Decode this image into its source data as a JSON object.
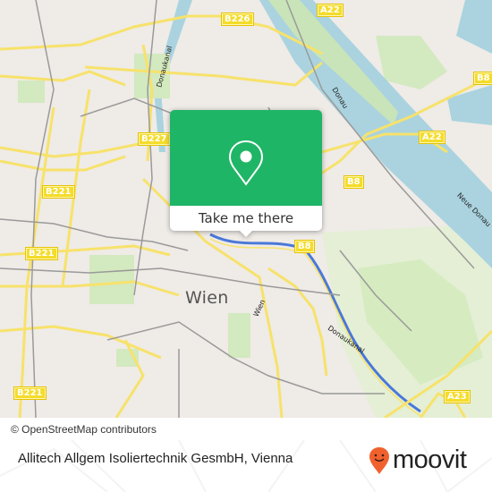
{
  "map": {
    "city_label": "Wien",
    "water_labels": {
      "danube": "Donau",
      "new_danube": "Neue Donau",
      "danube_canal": "Donaukanal",
      "wien_river": "Wien",
      "canal_north": "Donaukanal"
    },
    "road_shields": [
      {
        "id": "b226",
        "label": "B226"
      },
      {
        "id": "a22-top",
        "label": "A22"
      },
      {
        "id": "b227",
        "label": "B227"
      },
      {
        "id": "b8-right",
        "label": "B8"
      },
      {
        "id": "a22-mid",
        "label": "A22"
      },
      {
        "id": "b221-upper",
        "label": "B221"
      },
      {
        "id": "b8-center",
        "label": "B8"
      },
      {
        "id": "b221-mid",
        "label": "B221"
      },
      {
        "id": "b8-lower",
        "label": "B8"
      },
      {
        "id": "b221-lower",
        "label": "B221"
      },
      {
        "id": "a23",
        "label": "A23"
      }
    ],
    "colors": {
      "land": "#efebe7",
      "water": "#aad3df",
      "park": "#cdebb0",
      "major_road": "#f7e26b",
      "rail": "#999999"
    }
  },
  "popup": {
    "icon": "location-pin-icon",
    "button_label": "Take me there",
    "color": "#1fb566"
  },
  "attribution": "© OpenStreetMap contributors",
  "footer": {
    "place_name": "Allitech Allgem Isoliertechnik GesmbH, Vienna",
    "brand": {
      "name": "moovit",
      "icon": "moovit-smiley-pin-icon",
      "color": "#f0612e"
    }
  }
}
